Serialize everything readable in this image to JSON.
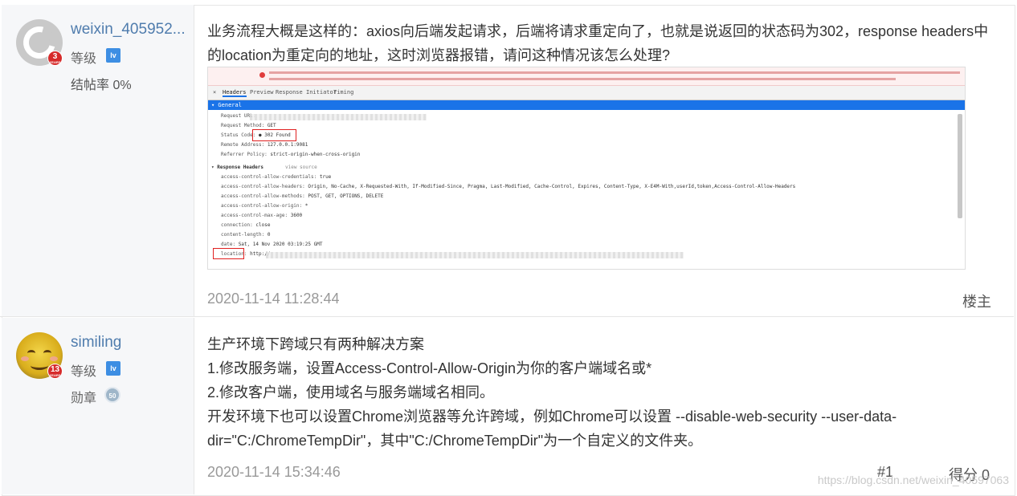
{
  "posts": [
    {
      "username": "weixin_405952...",
      "years": "3",
      "years_label": "YEARS",
      "level_label": "等级",
      "stat_label": "结帖率 0%",
      "paragraphs": [
        "业务流程大概是这样的：axios向后端发起请求，后端将请求重定向了，也就是说返回的状态码为302，response headers中的location为重定向的地址，这时浏览器报错，请问这种情况该怎么处理?"
      ],
      "timestamp": "2020-11-14 11:28:44",
      "role": "楼主"
    },
    {
      "username": "similing",
      "years": "13",
      "years_label": "YEARS",
      "level_label": "等级",
      "medal_label": "勋章",
      "medal_value": "50",
      "paragraphs": [
        "生产环境下跨域只有两种解决方案",
        "1.修改服务端，设置Access-Control-Allow-Origin为你的客户端域名或*",
        "2.修改客户端，使用域名与服务端域名相同。",
        "开发环境下也可以设置Chrome浏览器等允许跨域，例如Chrome可以设置 --disable-web-security --user-data-dir=\"C:/ChromeTempDir\"，其中\"C:/ChromeTempDir\"为一个自定义的文件夹。"
      ],
      "timestamp": "2020-11-14 15:34:46",
      "floor": "#1",
      "score": "得分 0"
    }
  ],
  "devtools": {
    "error_text": "Access to XMLHttpRequest at 'http://...' (redirected from 'http://...:9081/#/index') from origin 'http://...' has been blocked by CORS policy: Response to preflight request doesn't pass access control check: No 'Access-Control-Allow-Origin' header is present on the requested resource.",
    "tabs": [
      "Headers",
      "Preview",
      "Response",
      "Initiator",
      "Timing"
    ],
    "general_label": "▾ General",
    "general": [
      {
        "k": "Request URL:",
        "v": ""
      },
      {
        "k": "Request Method:",
        "v": "GET"
      },
      {
        "k": "Status Code:",
        "v": "● 302 Found"
      },
      {
        "k": "Remote Address:",
        "v": "127.0.0.1:9081"
      },
      {
        "k": "Referrer Policy:",
        "v": "strict-origin-when-cross-origin"
      }
    ],
    "response_label": "▾ Response Headers",
    "view_source": "view source",
    "response": [
      {
        "k": "access-control-allow-credentials:",
        "v": "true"
      },
      {
        "k": "access-control-allow-headers:",
        "v": "Origin, No-Cache, X-Requested-With, If-Modified-Since, Pragma, Last-Modified, Cache-Control, Expires, Content-Type, X-E4M-With,userId,token,Access-Control-Allow-Headers"
      },
      {
        "k": "access-control-allow-methods:",
        "v": "POST, GET, OPTIONS, DELETE"
      },
      {
        "k": "access-control-allow-origin:",
        "v": "*"
      },
      {
        "k": "access-control-max-age:",
        "v": "3600"
      },
      {
        "k": "connection:",
        "v": "close"
      },
      {
        "k": "content-length:",
        "v": "0"
      },
      {
        "k": "date:",
        "v": "Sat, 14 Nov 2020 03:19:25 GMT"
      },
      {
        "k": "location:",
        "v": "http://"
      }
    ]
  },
  "watermark": "https://blog.csdn.net/weixin_40597063"
}
